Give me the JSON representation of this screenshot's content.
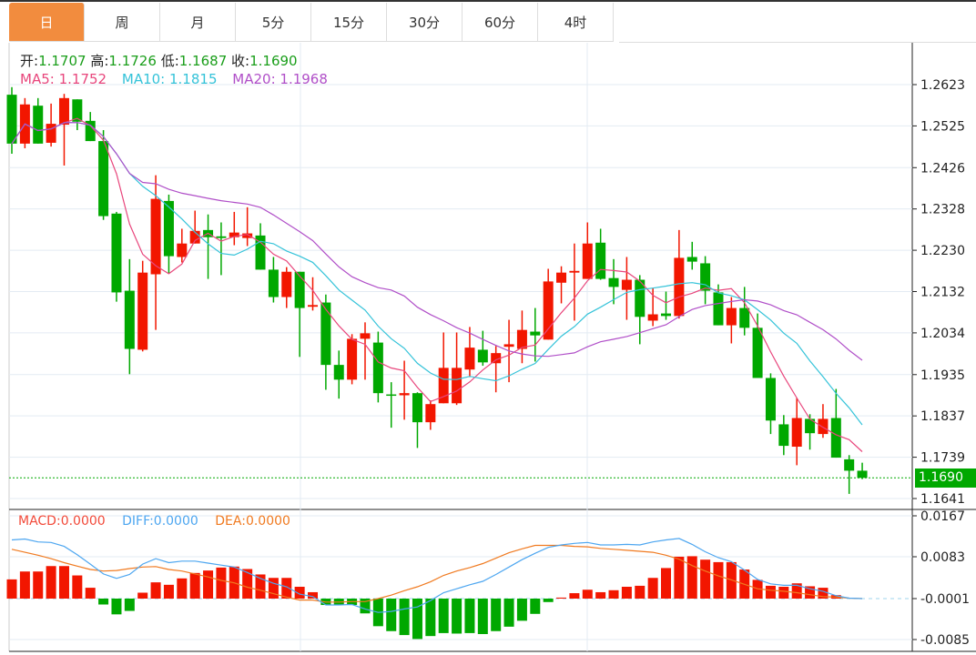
{
  "tabs": [
    "日",
    "周",
    "月",
    "5分",
    "15分",
    "30分",
    "60分",
    "4时"
  ],
  "active_tab": 0,
  "ohlc": {
    "open_label": "开:",
    "open": "1.1707",
    "high_label": "高:",
    "high": "1.1726",
    "low_label": "低:",
    "low": "1.1687",
    "close_label": "收:",
    "close": "1.1690"
  },
  "ma": {
    "ma5_label": "MA5:",
    "ma5": "1.1752",
    "ma10_label": "MA10:",
    "ma10": "1.1815",
    "ma20_label": "MA20:",
    "ma20": "1.1968"
  },
  "macd_info": {
    "macd_label": "MACD:",
    "macd": "0.0000",
    "diff_label": "DIFF:",
    "diff": "0.0000",
    "dea_label": "DEA:",
    "dea": "0.0000"
  },
  "current_price": "1.1690",
  "colors": {
    "up": "#F21600",
    "down": "#00A800",
    "ma5": "#E8467C",
    "ma10": "#35C3D9",
    "ma20": "#B04FC8",
    "diff": "#4DA6F0",
    "dea": "#F07A20",
    "accent": "#F28C3E"
  },
  "chart_data": [
    {
      "type": "candlestick",
      "title": "",
      "y_ticks": [
        "1.2623",
        "1.2525",
        "1.2426",
        "1.2328",
        "1.2230",
        "1.2132",
        "1.2034",
        "1.1935",
        "1.1837",
        "1.1739",
        "1.1641"
      ],
      "ylim": [
        1.1641,
        1.2623
      ],
      "grid": true,
      "candles_ohlc": [
        [
          1.2599,
          1.2483,
          1.2617,
          1.2459
        ],
        [
          1.2483,
          1.2576,
          1.2591,
          1.2472
        ],
        [
          1.2573,
          1.2483,
          1.2591,
          1.2483
        ],
        [
          1.2485,
          1.253,
          1.2578,
          1.2476
        ],
        [
          1.2528,
          1.2591,
          1.2601,
          1.2431
        ],
        [
          1.2588,
          1.2535,
          1.2588,
          1.2515
        ],
        [
          1.2537,
          1.2489,
          1.2558,
          1.2489
        ],
        [
          1.2489,
          1.2311,
          1.2515,
          1.2302
        ],
        [
          1.2317,
          1.213,
          1.2321,
          1.2108
        ],
        [
          1.2134,
          1.1996,
          1.2209,
          1.1936
        ],
        [
          1.1994,
          1.2177,
          1.2205,
          1.199
        ],
        [
          1.2173,
          1.2352,
          1.2408,
          1.2041
        ],
        [
          1.2347,
          1.2216,
          1.2362,
          1.2175
        ],
        [
          1.2214,
          1.2246,
          1.2281,
          1.2201
        ],
        [
          1.2246,
          1.2276,
          1.2324,
          1.2246
        ],
        [
          1.2278,
          1.2261,
          1.2315,
          1.2162
        ],
        [
          1.2263,
          1.2259,
          1.2296,
          1.2171
        ],
        [
          1.2261,
          1.2272,
          1.2321,
          1.2242
        ],
        [
          1.2259,
          1.227,
          1.2332,
          1.224
        ],
        [
          1.2265,
          1.2184,
          1.2294,
          1.2184
        ],
        [
          1.2184,
          1.2119,
          1.2214,
          1.2106
        ],
        [
          1.2119,
          1.2179,
          1.219,
          1.2093
        ],
        [
          1.2179,
          1.2093,
          1.2179,
          1.1977
        ],
        [
          1.2096,
          1.21,
          1.2166,
          1.2087
        ],
        [
          1.2106,
          1.1958,
          1.2125,
          1.1899
        ],
        [
          1.1958,
          1.1923,
          1.1992,
          1.1878
        ],
        [
          1.1923,
          1.202,
          1.2031,
          1.1912
        ],
        [
          1.202,
          1.2033,
          1.2059,
          1.1923
        ],
        [
          1.2011,
          1.1891,
          1.2037,
          1.1869
        ],
        [
          1.1888,
          1.1886,
          1.1917,
          1.1809
        ],
        [
          1.1886,
          1.1891,
          1.1968,
          1.1828
        ],
        [
          1.1891,
          1.1822,
          1.1893,
          1.1761
        ],
        [
          1.1822,
          1.1865,
          1.1874,
          1.1804
        ],
        [
          1.1867,
          1.1951,
          1.2035,
          1.1867
        ],
        [
          1.1867,
          1.1951,
          1.2035,
          1.1863
        ],
        [
          1.1947,
          1.1999,
          1.2048,
          1.1929
        ],
        [
          1.1994,
          1.1964,
          1.2039,
          1.1956
        ],
        [
          1.1962,
          1.1986,
          1.2003,
          1.1893
        ],
        [
          1.2001,
          1.2007,
          1.2065,
          1.1917
        ],
        [
          1.1996,
          1.2041,
          1.2087,
          1.1962
        ],
        [
          1.2037,
          1.2028,
          1.2093,
          1.1966
        ],
        [
          1.2018,
          1.2156,
          1.2186,
          1.2018
        ],
        [
          1.2153,
          1.2177,
          1.2192,
          1.2104
        ],
        [
          1.2177,
          1.2181,
          1.2246,
          1.2063
        ],
        [
          1.2162,
          1.2246,
          1.2296,
          1.2162
        ],
        [
          1.2248,
          1.2162,
          1.2281,
          1.216
        ],
        [
          1.2164,
          1.2143,
          1.2209,
          1.2102
        ],
        [
          1.2136,
          1.216,
          1.2214,
          1.2065
        ],
        [
          1.216,
          1.2072,
          1.2171,
          1.2007
        ],
        [
          1.2063,
          1.2078,
          1.2141,
          1.205
        ],
        [
          1.208,
          1.2074,
          1.2132,
          1.2065
        ],
        [
          1.2074,
          1.2212,
          1.2278,
          1.2068
        ],
        [
          1.2214,
          1.2203,
          1.225,
          1.2184
        ],
        [
          1.2199,
          1.2134,
          1.2216,
          1.2102
        ],
        [
          1.213,
          1.2052,
          1.2149,
          1.2052
        ],
        [
          1.2052,
          1.2093,
          1.2119,
          1.2009
        ],
        [
          1.2093,
          1.2046,
          1.2143,
          1.2028
        ],
        [
          1.2046,
          1.1927,
          1.208,
          1.1927
        ],
        [
          1.1927,
          1.1826,
          1.1938,
          1.1794
        ],
        [
          1.1817,
          1.1766,
          1.1839,
          1.1744
        ],
        [
          1.1764,
          1.1832,
          1.188,
          1.172
        ],
        [
          1.183,
          1.1796,
          1.1841,
          1.1757
        ],
        [
          1.1794,
          1.183,
          1.1865,
          1.1785
        ],
        [
          1.1832,
          1.1738,
          1.1901,
          1.1738
        ],
        [
          1.1734,
          1.1707,
          1.1744,
          1.1652
        ],
        [
          1.1707,
          1.169,
          1.1726,
          1.1687
        ]
      ],
      "ma_periods": [
        5,
        10,
        20
      ]
    },
    {
      "type": "bar",
      "title": "MACD",
      "y_ticks": [
        "0.0167",
        "0.0083",
        "-0.0001",
        "-0.0085"
      ],
      "ylim": [
        -0.0085,
        0.0167
      ],
      "macd": [
        0.0039,
        0.0055,
        0.0055,
        0.0066,
        0.0066,
        0.0047,
        0.0022,
        -0.0012,
        -0.0032,
        -0.0025,
        0.0012,
        0.0033,
        0.0028,
        0.0041,
        0.0052,
        0.0057,
        0.0063,
        0.0065,
        0.006,
        0.0049,
        0.0042,
        0.0042,
        0.0024,
        0.0013,
        -0.0013,
        -0.0013,
        -0.0013,
        -0.003,
        -0.0056,
        -0.0066,
        -0.0074,
        -0.0082,
        -0.0076,
        -0.007,
        -0.0071,
        -0.007,
        -0.0072,
        -0.0066,
        -0.0057,
        -0.0045,
        -0.0031,
        -0.0007,
        0.0002,
        0.0011,
        0.0018,
        0.0013,
        0.0017,
        0.0024,
        0.0026,
        0.0042,
        0.0062,
        0.0085,
        0.0086,
        0.0079,
        0.0074,
        0.0074,
        0.0059,
        0.0038,
        0.0026,
        0.0024,
        0.0031,
        0.0025,
        0.0022,
        0.0007,
        0,
        0
      ],
      "diff": [
        0.0119,
        0.0121,
        0.0115,
        0.0114,
        0.0106,
        0.0089,
        0.007,
        0.005,
        0.0041,
        0.0049,
        0.007,
        0.0081,
        0.0073,
        0.0076,
        0.0076,
        0.0072,
        0.0068,
        0.0064,
        0.0053,
        0.0041,
        0.0031,
        0.0024,
        0.0009,
        0.0004,
        -0.0013,
        -0.0013,
        -0.0012,
        -0.0021,
        -0.0028,
        -0.0026,
        -0.0021,
        -0.0017,
        -0.0004,
        0.0012,
        0.002,
        0.0028,
        0.0035,
        0.0049,
        0.0064,
        0.0079,
        0.0092,
        0.0104,
        0.0109,
        0.0112,
        0.0114,
        0.0109,
        0.0109,
        0.011,
        0.0109,
        0.0115,
        0.0119,
        0.0122,
        0.011,
        0.0095,
        0.0083,
        0.0075,
        0.0058,
        0.0039,
        0.003,
        0.0027,
        0.0027,
        0.002,
        0.0015,
        0.0006,
        0.0001,
        0.0
      ],
      "dea": [
        0.01,
        0.0094,
        0.0088,
        0.0081,
        0.0073,
        0.0066,
        0.0059,
        0.0056,
        0.0057,
        0.0061,
        0.0064,
        0.0065,
        0.0059,
        0.0056,
        0.005,
        0.0044,
        0.0037,
        0.0032,
        0.0023,
        0.0017,
        0.001,
        0.0003,
        -0.0003,
        -0.0003,
        -0.0007,
        -0.0007,
        -0.0006,
        -0.0006,
        0.0,
        0.0007,
        0.0016,
        0.0024,
        0.0034,
        0.0047,
        0.0056,
        0.0063,
        0.0071,
        0.0082,
        0.0093,
        0.0101,
        0.0108,
        0.0108,
        0.0108,
        0.0106,
        0.0105,
        0.0102,
        0.01,
        0.0098,
        0.0096,
        0.0094,
        0.0088,
        0.008,
        0.0067,
        0.0056,
        0.0046,
        0.0038,
        0.0029,
        0.002,
        0.0017,
        0.0015,
        0.0012,
        0.0008,
        0.0004,
        0.0003,
        0.0001,
        0.0
      ]
    }
  ]
}
